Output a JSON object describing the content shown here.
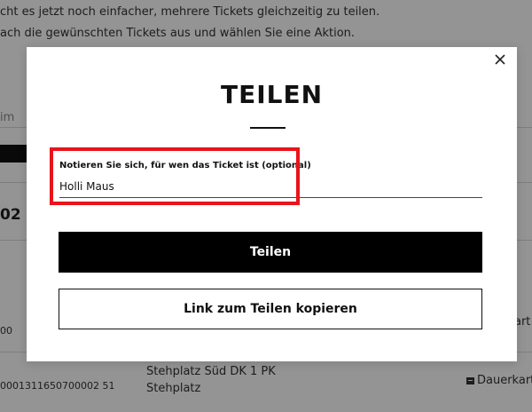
{
  "background": {
    "intro_line_1": "cht es jetzt noch einfacher, mehrere Tickets gleichzeitig zu teilen.",
    "intro_line_2": "ach die gewünschten Tickets aus und wählen Sie eine Aktion.",
    "search_fragment": "im",
    "heading_fragment": "02",
    "rows": [
      {
        "id_fragment": "00",
        "badge_fragment": "art"
      },
      {
        "id_fragment": "0001311650700002 51",
        "seat": "Stehplatz Süd DK 1 PK",
        "category": "Stehplatz",
        "badge": "Dauerkart"
      }
    ]
  },
  "modal": {
    "close_symbol": "×",
    "title": "TEILEN",
    "field_label": "Notieren Sie sich, für wen das Ticket ist (optional)",
    "field_value": "Holli Maus",
    "share_button": "Teilen",
    "copy_link_button": "Link zum Teilen kopieren"
  },
  "colors": {
    "highlight": "#e8141b",
    "primary_button": "#000000",
    "overlay": "rgba(0,0,0,0.42)"
  }
}
